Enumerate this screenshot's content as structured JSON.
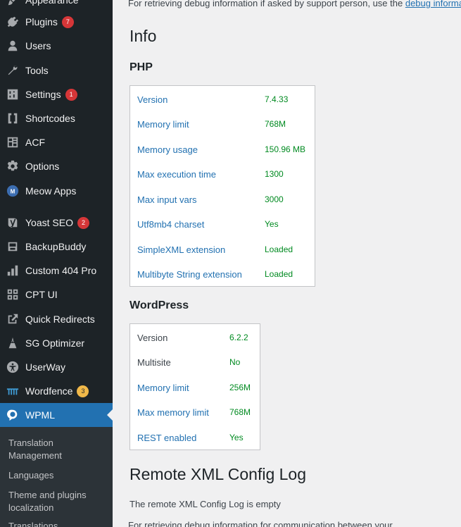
{
  "sidebar": {
    "items": [
      {
        "label": "Appearance",
        "icon": "paintbrush-icon"
      },
      {
        "label": "Plugins",
        "icon": "plug-icon",
        "badge": "7"
      },
      {
        "label": "Users",
        "icon": "user-icon"
      },
      {
        "label": "Tools",
        "icon": "wrench-icon"
      },
      {
        "label": "Settings",
        "icon": "settings-sliders-icon",
        "badge": "1"
      },
      {
        "label": "Shortcodes",
        "icon": "brackets-icon"
      },
      {
        "label": "ACF",
        "icon": "layout-icon"
      },
      {
        "label": "Options",
        "icon": "gear-icon"
      },
      {
        "label": "Meow Apps",
        "icon": "meow-logo-icon"
      },
      {
        "label": "Yoast SEO",
        "icon": "yoast-icon",
        "badge": "2"
      },
      {
        "label": "BackupBuddy",
        "icon": "backup-icon"
      },
      {
        "label": "Custom 404 Pro",
        "icon": "bar-chart-icon"
      },
      {
        "label": "CPT UI",
        "icon": "grid-icon"
      },
      {
        "label": "Quick Redirects",
        "icon": "external-link-icon"
      },
      {
        "label": "SG Optimizer",
        "icon": "sg-optimizer-icon"
      },
      {
        "label": "UserWay",
        "icon": "accessibility-icon"
      },
      {
        "label": "Wordfence",
        "icon": "wordfence-icon",
        "badge": "3"
      },
      {
        "label": "WPML",
        "icon": "wpml-icon"
      }
    ],
    "submenu": [
      "Translation Management",
      "Languages",
      "Theme and plugins localization",
      "Translations"
    ]
  },
  "main": {
    "top_text": "For retrieving debug information if asked by support person, use the",
    "top_link": "debug information",
    "info_title": "Info",
    "php_title": "PHP",
    "php_rows": [
      {
        "key": "Version",
        "value": "7.4.33"
      },
      {
        "key": "Memory limit",
        "value": "768M"
      },
      {
        "key": "Memory usage",
        "value": "150.96 MB"
      },
      {
        "key": "Max execution time",
        "value": "1300"
      },
      {
        "key": "Max input vars",
        "value": "3000"
      },
      {
        "key": "Utf8mb4 charset",
        "value": "Yes"
      },
      {
        "key": "SimpleXML extension",
        "value": "Loaded"
      },
      {
        "key": "Multibyte String extension",
        "value": "Loaded"
      }
    ],
    "wp_title": "WordPress",
    "wp_rows": [
      {
        "key": "Version",
        "value": "6.2.2"
      },
      {
        "key": "Multisite",
        "value": "No"
      },
      {
        "key": "Memory limit",
        "value": "256M"
      },
      {
        "key": "Max memory limit",
        "value": "768M"
      },
      {
        "key": "REST enabled",
        "value": "Yes"
      }
    ],
    "remote_title": "Remote XML Config Log",
    "remote_empty": "The remote XML Config Log is empty",
    "bottom_text": "For retrieving debug information for communication between your"
  },
  "colors": {
    "sidebar_bg": "#1d2327",
    "active_bg": "#2271b1",
    "link": "#2271b1",
    "value_green": "#008a20",
    "badge_red": "#d63638",
    "badge_orange": "#f0b849"
  }
}
